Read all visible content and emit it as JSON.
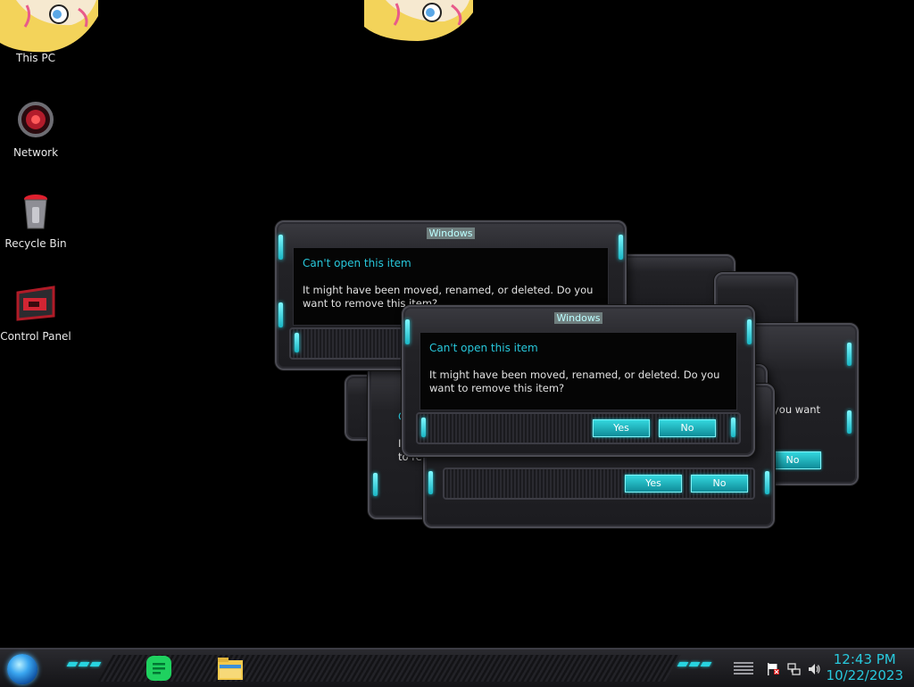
{
  "desktop": {
    "icons": [
      {
        "label": "This PC"
      },
      {
        "label": "Network"
      },
      {
        "label": "Recycle Bin"
      },
      {
        "label": "Control Panel"
      }
    ]
  },
  "dialog": {
    "window_title": "Windows",
    "heading": "Can't open this item",
    "message": "It might have been moved, renamed, or deleted. Do you want to remove this item?",
    "yes_label": "Yes",
    "no_label": "No",
    "partial_heading": "C",
    "partial_line1": "It",
    "partial_line2": "to re",
    "partial_right": "you want"
  },
  "taskbar": {
    "apps": [
      "notes-app-icon",
      "file-explorer-icon"
    ],
    "tray": [
      "flag-icon",
      "network-icon",
      "volume-icon"
    ],
    "time": "12:43 PM",
    "date": "10/22/2023"
  },
  "colors": {
    "accent": "#28c8dc",
    "background": "#000000"
  }
}
